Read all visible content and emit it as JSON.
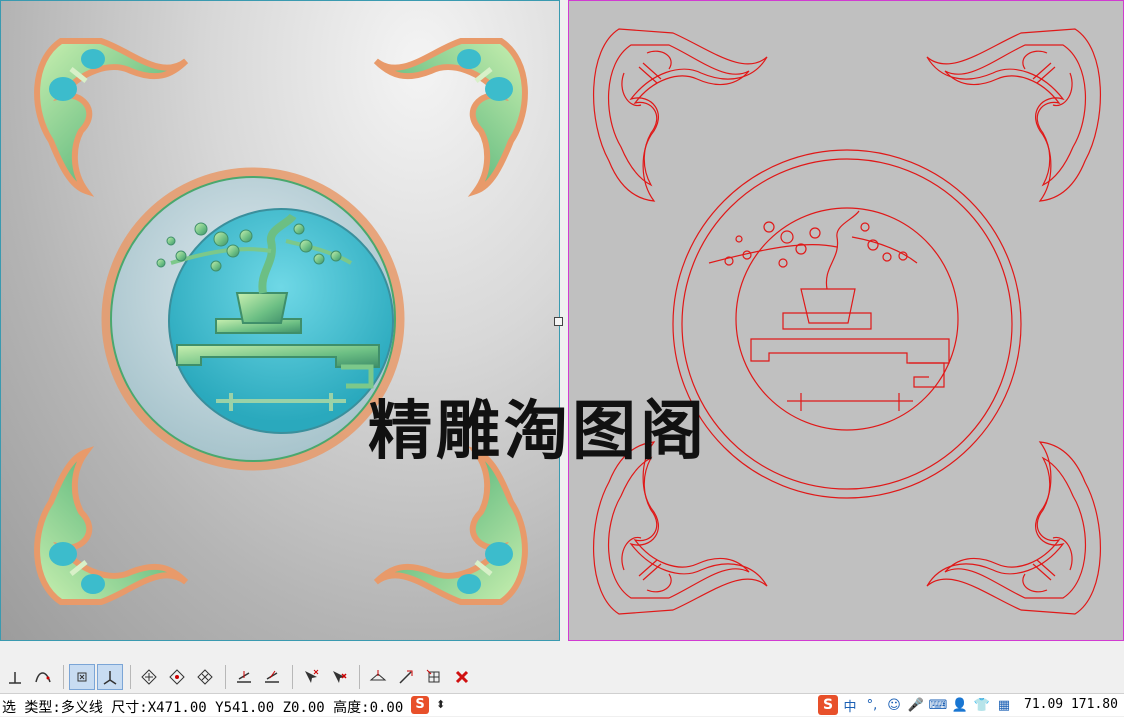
{
  "watermark": "精雕淘图阁",
  "status": {
    "text": "选 类型:多义线 尺寸:X471.00 Y541.00 Z0.00 高度:0.00",
    "coordinates": "71.09 171.80"
  },
  "ime": {
    "logo": "S",
    "lang": "中",
    "punct": "°,"
  },
  "toolbar": {
    "buttons": [
      {
        "name": "perpendicular-icon",
        "active": false
      },
      {
        "name": "curve-snap-icon",
        "active": false
      },
      {
        "name": "point-snap-icon",
        "active": true
      },
      {
        "name": "axis-snap-icon",
        "active": true
      },
      {
        "name": "diamond-cross-icon",
        "active": false
      },
      {
        "name": "diamond-dot-icon",
        "active": false
      },
      {
        "name": "diamond-x-icon",
        "active": false
      },
      {
        "name": "layer-up-icon",
        "active": false
      },
      {
        "name": "layer-down-icon",
        "active": false
      },
      {
        "name": "select-add-icon",
        "active": false
      },
      {
        "name": "select-remove-icon",
        "active": false
      },
      {
        "name": "eye-arrow-icon",
        "active": false
      },
      {
        "name": "pen-arrow-icon",
        "active": false
      },
      {
        "name": "grid-edit-icon",
        "active": false
      },
      {
        "name": "delete-icon",
        "active": false
      }
    ]
  },
  "colors": {
    "left_border": "#3a9ab0",
    "right_border": "#d13bd1",
    "outline": "#e01818",
    "relief_green": "#7cc88a",
    "relief_cyan": "#3cbccc",
    "relief_orange": "#e89a6a"
  }
}
